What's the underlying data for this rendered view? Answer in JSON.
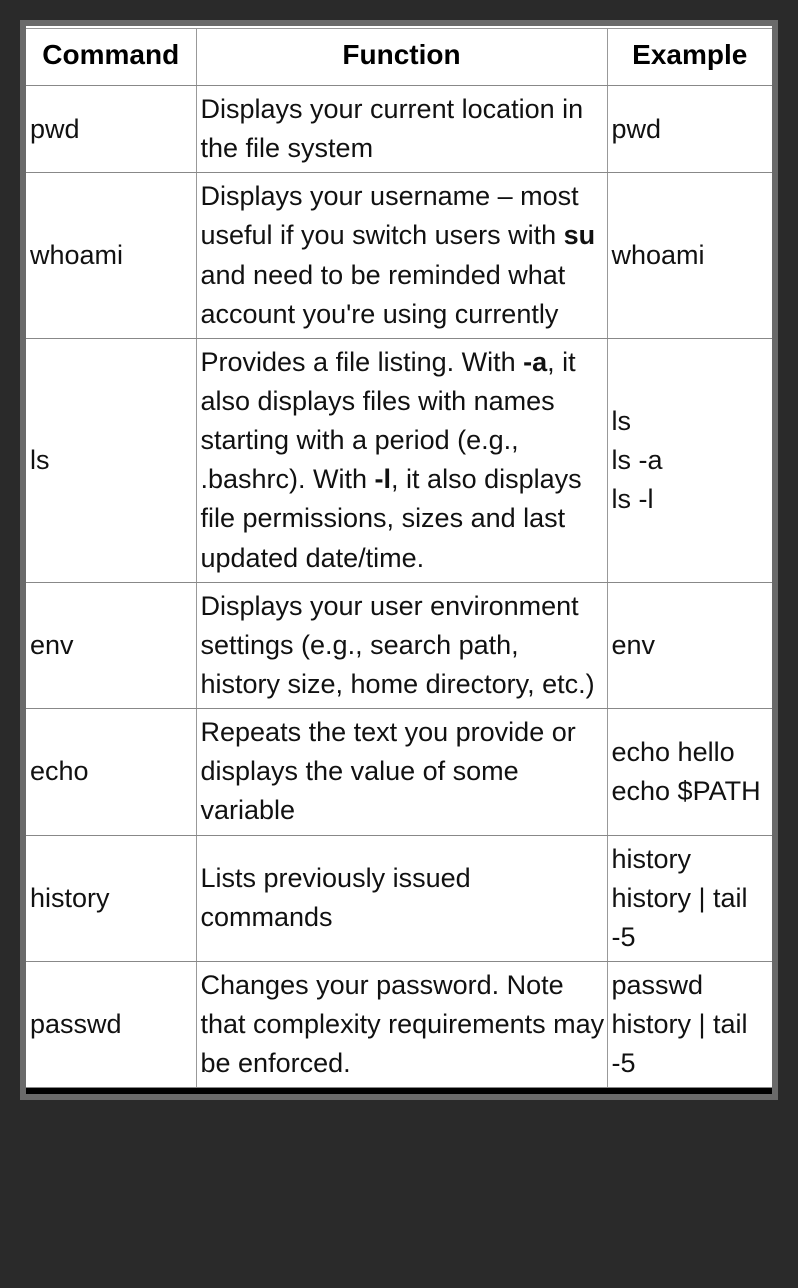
{
  "headers": {
    "command": "Command",
    "function": "Function",
    "example": "Example"
  },
  "rows": [
    {
      "command": "pwd",
      "function_html": "Displays your current location in the file system",
      "example_html": "pwd"
    },
    {
      "command": "whoami",
      "function_html": "Displays your username – most useful if you switch users with <b>su</b> and need to be reminded what account you're using currently",
      "example_html": "whoami"
    },
    {
      "command": "ls",
      "function_html": "Provides a file listing. With <b>-a</b>, it also displays files with names starting with a period (e.g., .bashrc). With <b>-l</b>, it also displays file permissions, sizes and last updated date/time.",
      "example_html": "ls<br>ls -a<br>ls -l"
    },
    {
      "command": "env",
      "function_html": "Displays your user environment settings (e.g., search path, history size, home directory, etc.)",
      "example_html": "env"
    },
    {
      "command": "echo",
      "function_html": "Repeats the text you provide or displays the value of some variable",
      "example_html": "echo hello<br>echo $PATH"
    },
    {
      "command": "history",
      "function_html": "Lists previously issued commands",
      "example_html": "history<br>history | tail -5"
    },
    {
      "command": "passwd",
      "function_html": "Changes your password. Note that complexity requirements may be enforced.",
      "example_html": "passwd<br>history | tail -5"
    }
  ]
}
